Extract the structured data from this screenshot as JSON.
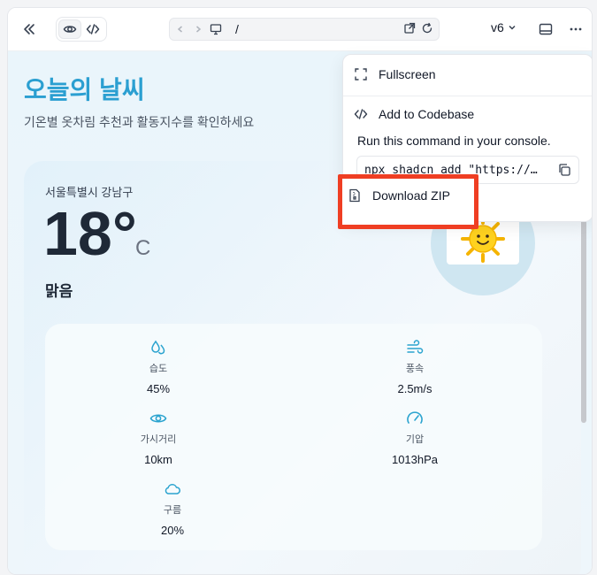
{
  "toolbar": {
    "collapse_icon": "double-chevron-left-icon",
    "view_toggle": [
      "eye-icon",
      "code-icon"
    ],
    "url_path": "/",
    "version_label": "v6",
    "panel_icon": "panel-icon",
    "more_icon": "more-icon"
  },
  "page": {
    "title": "오늘의 날씨",
    "subtitle": "기온별 옷차림 추천과 활동지수를 확인하세요",
    "location": "서울특별시 강남구",
    "temperature": "18°",
    "unit": "C",
    "condition": "맑음",
    "stats": [
      {
        "icon": "droplets-icon",
        "label": "습도",
        "value": "45%"
      },
      {
        "icon": "wind-icon",
        "label": "풍속",
        "value": "2.5m/s"
      },
      {
        "icon": "eye-icon",
        "label": "가시거리",
        "value": "10km"
      },
      {
        "icon": "gauge-icon",
        "label": "기압",
        "value": "1013hPa"
      },
      {
        "icon": "cloud-icon",
        "label": "구름",
        "value": "20%"
      }
    ]
  },
  "menu": {
    "fullscreen": "Fullscreen",
    "add_to_codebase": "Add to Codebase",
    "description": "Run this command in your console.",
    "command": "npx shadcn add \"https://…",
    "download_zip": "Download ZIP"
  },
  "colors": {
    "accent": "#2b9fd1",
    "highlight": "#ef3e23"
  }
}
